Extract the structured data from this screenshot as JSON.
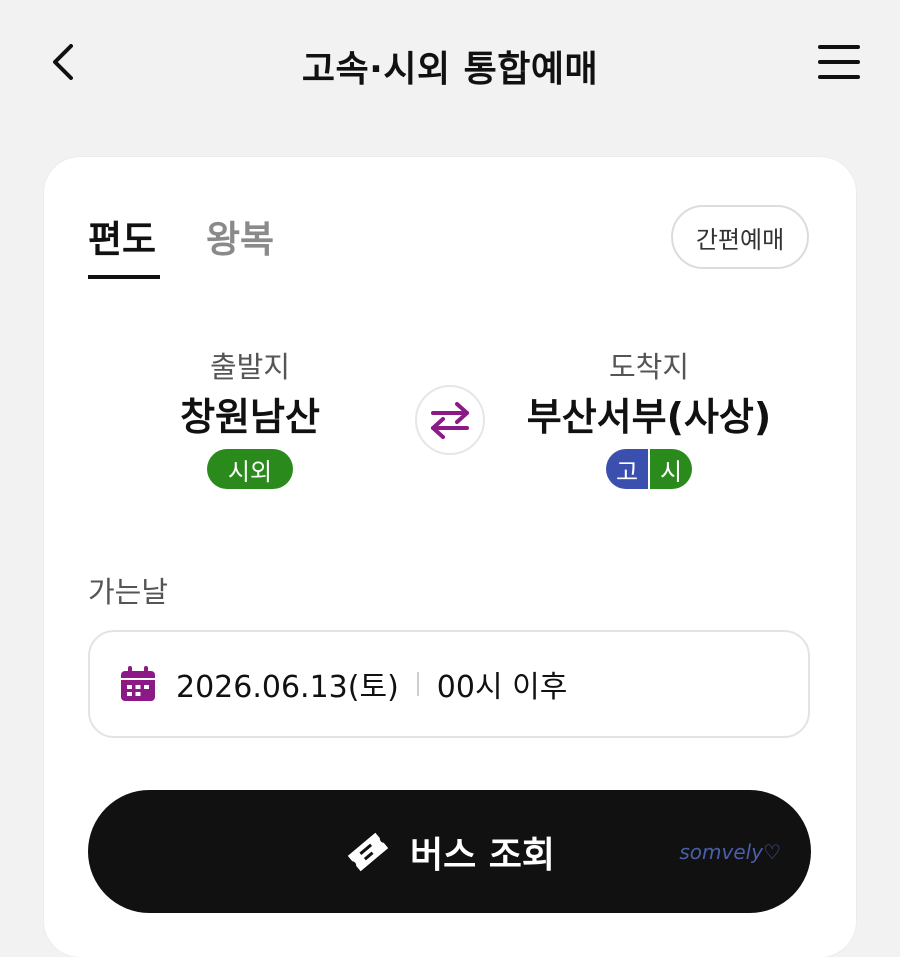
{
  "header": {
    "title": "고속·시외 통합예매"
  },
  "tabs": [
    {
      "label": "편도",
      "active": true
    },
    {
      "label": "왕복",
      "active": false
    }
  ],
  "quick_booking_label": "간편예매",
  "departure": {
    "caption": "출발지",
    "name": "창원남산",
    "badge": "시외"
  },
  "arrival": {
    "caption": "도착지",
    "name": "부산서부(사상)",
    "badge_express": "고",
    "badge_intercity": "시"
  },
  "date": {
    "label": "가는날",
    "value": "2026.06.13(토)",
    "time": "00시 이후"
  },
  "search_button_label": "버스 조회",
  "watermark": "somvely♡",
  "colors": {
    "accent_purple": "#8b1a87",
    "intercity_green": "#2a8a1c",
    "express_blue": "#3b4fae",
    "button_black": "#111111"
  },
  "icons": {
    "back": "chevron-left-icon",
    "menu": "hamburger-menu-icon",
    "swap": "swap-arrows-icon",
    "calendar": "calendar-icon",
    "ticket": "ticket-icon"
  }
}
